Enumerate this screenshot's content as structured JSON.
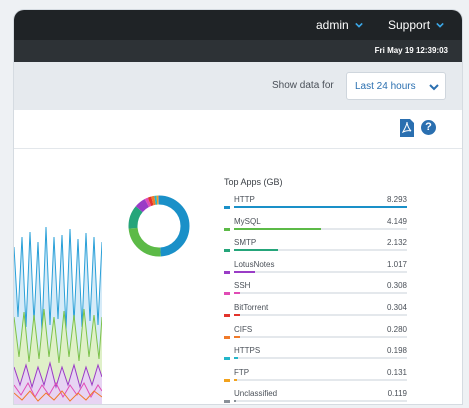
{
  "header": {
    "user_menu": "admin",
    "support_menu": "Support",
    "datetime": "Fri May 19 12:39:03"
  },
  "filter": {
    "label": "Show data for",
    "selected": "Last 24 hours"
  },
  "colors": {
    "accent": "#2a6fb0",
    "topbar": "#1f2326"
  },
  "icons": {
    "export": "pdf-icon",
    "help": "help-icon"
  },
  "top_apps": {
    "title": "Top Apps (GB)",
    "items": [
      {
        "name": "HTTP",
        "value": "8.293",
        "color": "#1a90c8"
      },
      {
        "name": "MySQL",
        "value": "4.149",
        "color": "#5cba47"
      },
      {
        "name": "SMTP",
        "value": "2.132",
        "color": "#25a57a"
      },
      {
        "name": "LotusNotes",
        "value": "1.017",
        "color": "#9a3cc6"
      },
      {
        "name": "SSH",
        "value": "0.308",
        "color": "#e04bb5"
      },
      {
        "name": "BitTorrent",
        "value": "0.304",
        "color": "#e2342c"
      },
      {
        "name": "CIFS",
        "value": "0.280",
        "color": "#f07a2a"
      },
      {
        "name": "HTTPS",
        "value": "0.198",
        "color": "#23b6c9"
      },
      {
        "name": "FTP",
        "value": "0.131",
        "color": "#f2a21c"
      },
      {
        "name": "Unclassified",
        "value": "0.119",
        "color": "#8a9199"
      }
    ]
  }
}
